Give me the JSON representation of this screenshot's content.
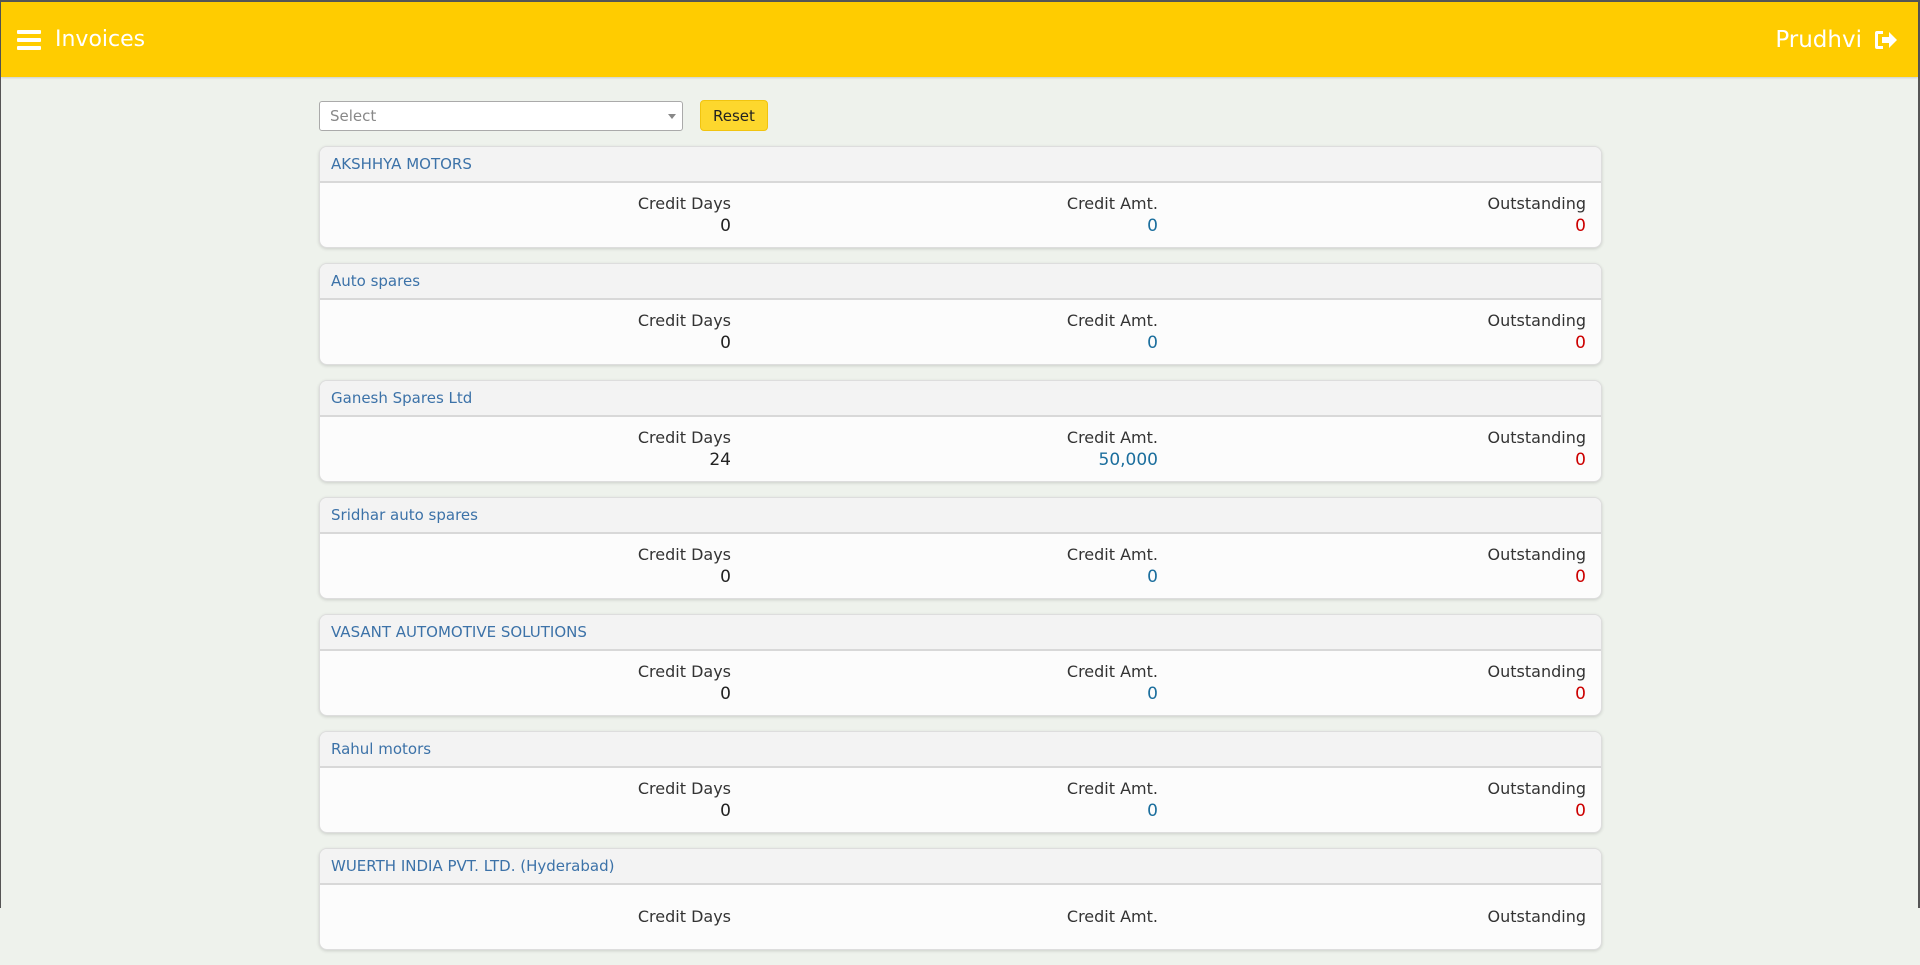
{
  "header": {
    "title": "Invoices",
    "user": "Prudhvi"
  },
  "filter": {
    "placeholder": "Select",
    "reset_label": "Reset"
  },
  "labels": {
    "credit_days": "Credit Days",
    "credit_amt": "Credit Amt.",
    "outstanding": "Outstanding"
  },
  "customers": [
    {
      "name": "AKSHHYA MOTORS",
      "credit_days": "0",
      "credit_amt": "0",
      "outstanding": "0"
    },
    {
      "name": "Auto spares",
      "credit_days": "0",
      "credit_amt": "0",
      "outstanding": "0"
    },
    {
      "name": "Ganesh Spares Ltd",
      "credit_days": "24",
      "credit_amt": "50,000",
      "outstanding": "0"
    },
    {
      "name": "Sridhar auto spares",
      "credit_days": "0",
      "credit_amt": "0",
      "outstanding": "0"
    },
    {
      "name": "VASANT AUTOMOTIVE SOLUTIONS",
      "credit_days": "0",
      "credit_amt": "0",
      "outstanding": "0"
    },
    {
      "name": "Rahul motors",
      "credit_days": "0",
      "credit_amt": "0",
      "outstanding": "0"
    },
    {
      "name": "WUERTH INDIA PVT. LTD. (Hyderabad)",
      "credit_days": "",
      "credit_amt": "",
      "outstanding": ""
    }
  ],
  "colors": {
    "accent": "#ffcc00",
    "link": "#3c72a8",
    "amount": "#1b6e9d",
    "outstanding": "#cc0000"
  }
}
